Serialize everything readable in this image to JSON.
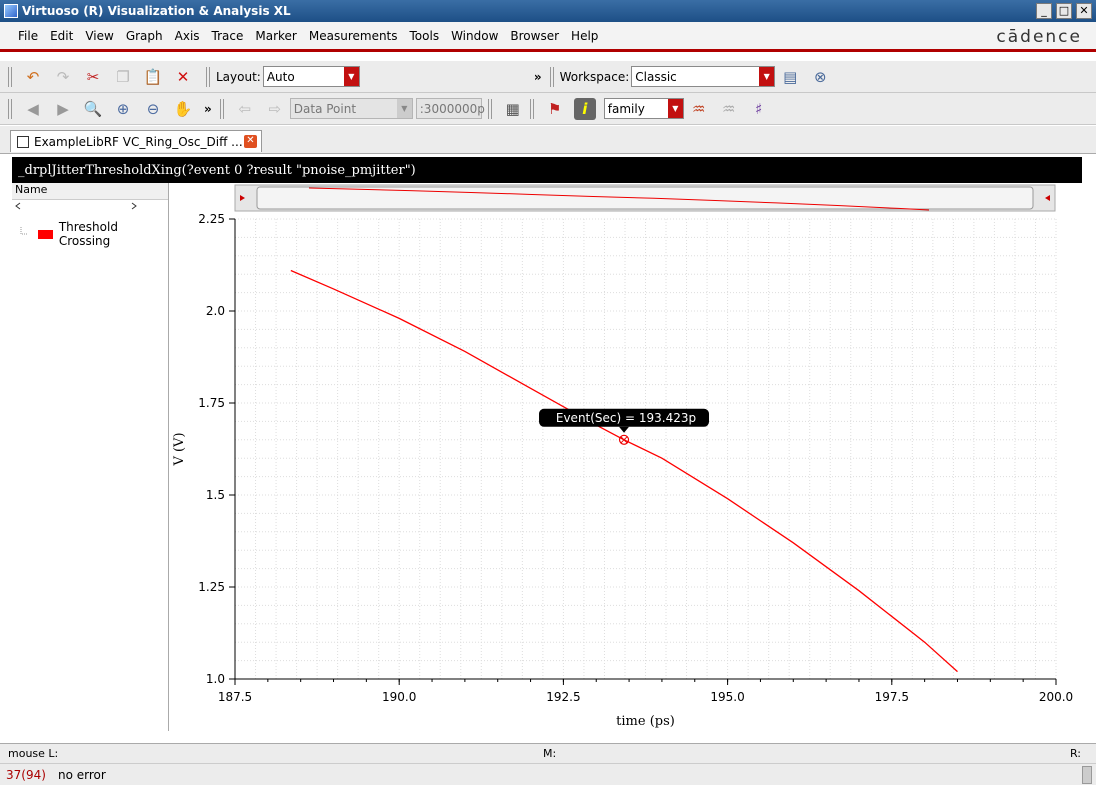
{
  "window": {
    "title": "Virtuoso (R) Visualization & Analysis XL",
    "min": "_",
    "max": "□",
    "close": "✕"
  },
  "menu": [
    "File",
    "Edit",
    "View",
    "Graph",
    "Axis",
    "Trace",
    "Marker",
    "Measurements",
    "Tools",
    "Window",
    "Browser",
    "Help"
  ],
  "brand": "cādence",
  "toolbar1": {
    "layout_label": "Layout:",
    "layout_value": "Auto",
    "workspace_label": "Workspace:",
    "workspace_value": "Classic",
    "chevron": "»"
  },
  "toolbar2": {
    "marker_type": "Data Point",
    "marker_value": ":3000000p",
    "family_value": "family",
    "chevron": "»"
  },
  "tab": {
    "label": "ExampleLibRF VC_Ring_Osc_Diff ...",
    "close": "✕"
  },
  "expression": "_drplJitterThresholdXing(?event 0 ?result \"pnoise_pmjitter\")",
  "legend_panel": {
    "header": "Name",
    "items": [
      {
        "label": "Threshold Crossing",
        "color": "#ff0000"
      }
    ]
  },
  "chart_data": {
    "type": "line",
    "xlabel": "time (ps)",
    "ylabel": "V (V)",
    "xlim": [
      187.5,
      200.0
    ],
    "ylim": [
      1.0,
      2.25
    ],
    "xticks": [
      "187.5",
      "190.0",
      "192.5",
      "195.0",
      "197.5",
      "200.0"
    ],
    "yticks": [
      "1.0",
      "1.25",
      "1.5",
      "1.75",
      "2.0",
      "2.25"
    ],
    "grid": true,
    "series": [
      {
        "name": "Threshold Crossing",
        "color": "#ff0000",
        "x": [
          188.35,
          189.0,
          190.0,
          191.0,
          192.0,
          193.0,
          193.423,
          194.0,
          195.0,
          196.0,
          197.0,
          198.0,
          198.5
        ],
        "y": [
          2.11,
          2.06,
          1.98,
          1.89,
          1.79,
          1.69,
          1.65,
          1.6,
          1.49,
          1.37,
          1.24,
          1.1,
          1.02
        ]
      }
    ],
    "marker": {
      "x": 193.423,
      "y": 1.65,
      "label": "Event(Sec) = 193.423p"
    }
  },
  "mousebar": {
    "left": "mouse L:",
    "mid": "M:",
    "right": "R:"
  },
  "status": {
    "count": "37(94)",
    "message": "no error"
  }
}
